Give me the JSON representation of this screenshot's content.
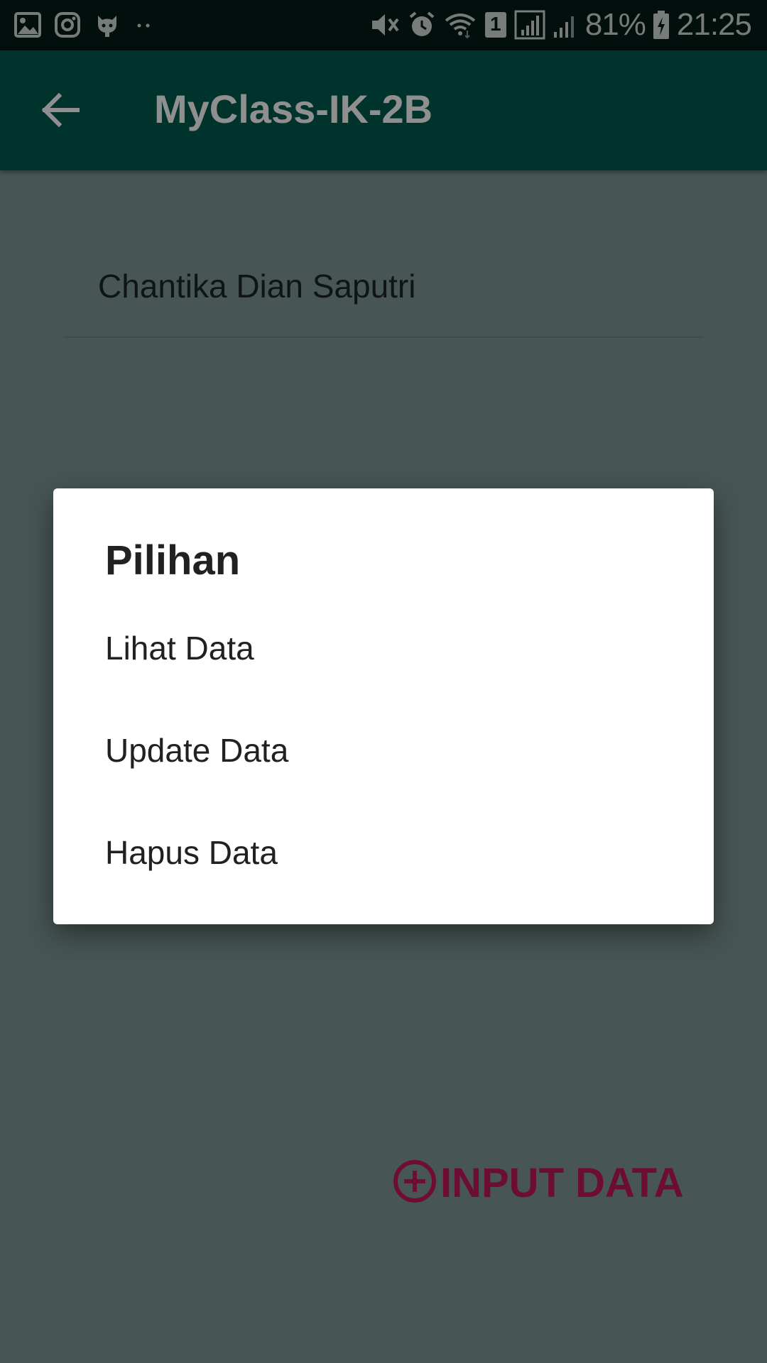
{
  "status_bar": {
    "left_icons": [
      "gallery-icon",
      "instagram-icon",
      "github-icon",
      "more-dots-icon"
    ],
    "right_icons": [
      "mute-icon",
      "alarm-icon",
      "wifi-icon",
      "sim-1-icon",
      "signal-icon",
      "signal-2-icon",
      "battery-charging-icon"
    ],
    "sim_number": "1",
    "battery": "81%",
    "time": "21:25"
  },
  "app_bar": {
    "title": "MyClass-IK-2B",
    "background": "#005b4f"
  },
  "content": {
    "list_items": [
      "Chantika Dian Saputri"
    ],
    "input_button_label": "INPUT DATA",
    "accent": "#c2185b"
  },
  "dialog": {
    "title": "Pilihan",
    "options": [
      "Lihat Data",
      "Update Data",
      "Hapus Data"
    ]
  }
}
